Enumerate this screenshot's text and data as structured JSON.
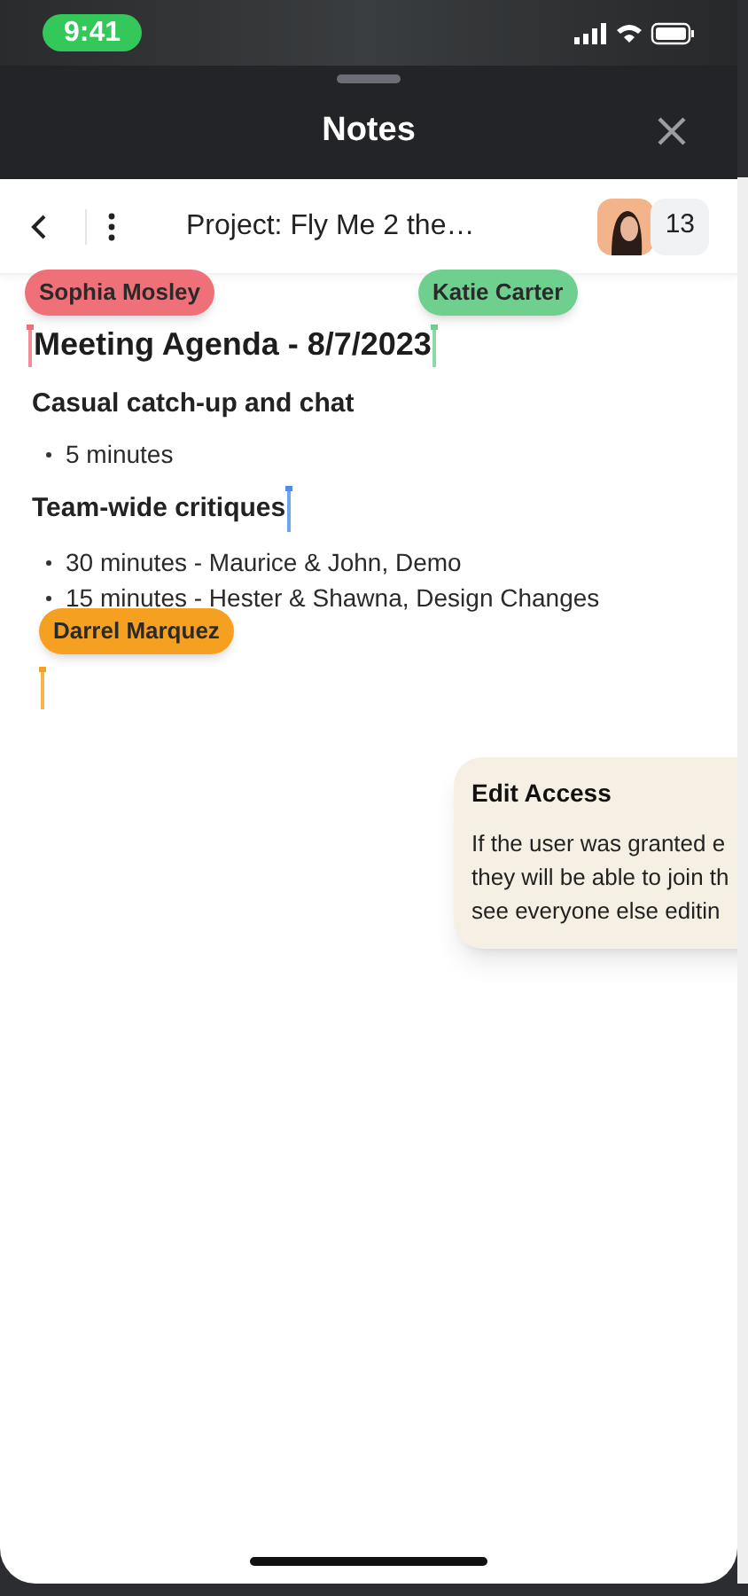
{
  "status_bar": {
    "time": "9:41"
  },
  "sheet": {
    "title": "Notes"
  },
  "toolbar": {
    "title": "Project: Fly Me 2 the…",
    "participant_count": "13"
  },
  "collaborators": [
    {
      "name": "Sophia Mosley",
      "color": "#f0707a"
    },
    {
      "name": "Katie Carter",
      "color": "#6fcf8f"
    },
    {
      "name": "Darrel Marquez",
      "color": "#f5a021"
    }
  ],
  "document": {
    "title": "Meeting Agenda - 8/7/2023",
    "sections": [
      {
        "heading": "Casual catch-up and chat",
        "items": [
          "5 minutes"
        ]
      },
      {
        "heading": "Team-wide critiques",
        "items": [
          "30 minutes - Maurice & John, Demo",
          "15 minutes - Hester & Shawna, Design Changes"
        ]
      }
    ]
  },
  "tooltip": {
    "title": "Edit Access",
    "lines": [
      "If the user was granted e",
      "they will be able to join th",
      "see everyone else editin"
    ]
  }
}
